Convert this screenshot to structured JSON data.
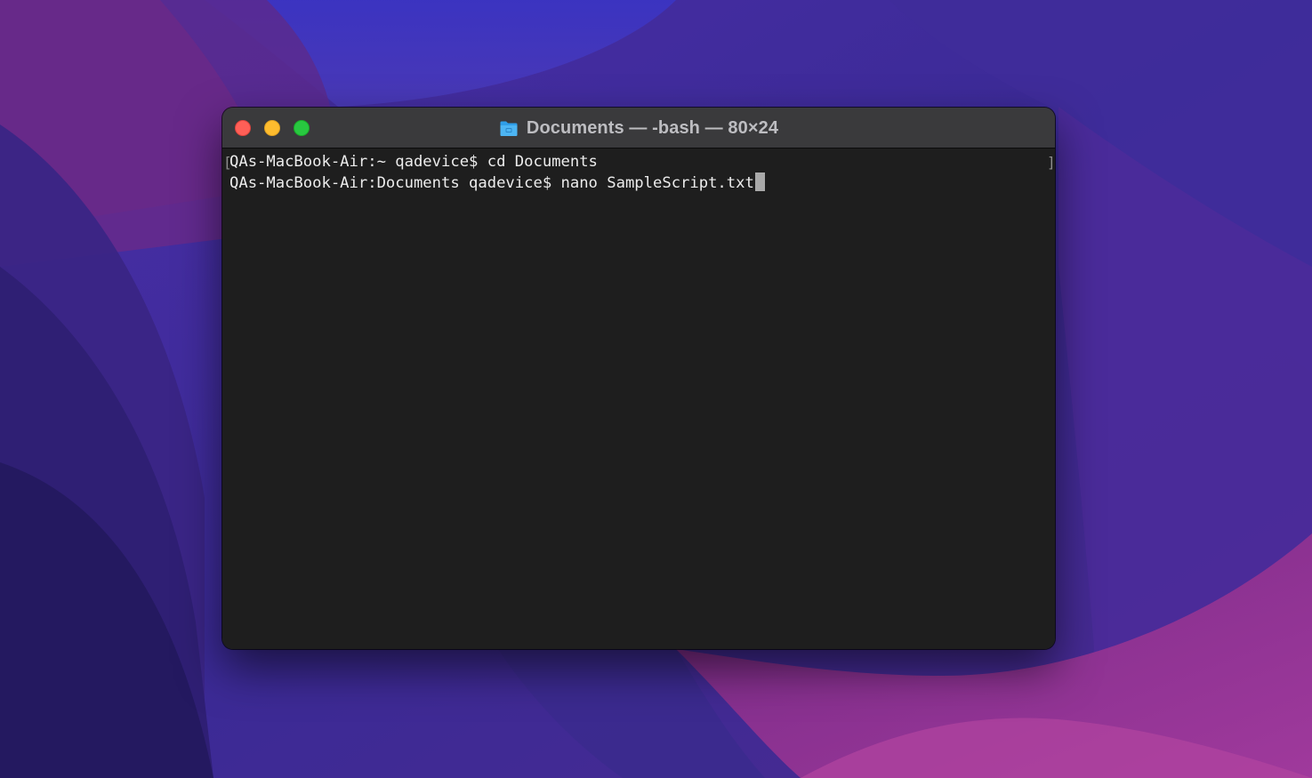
{
  "window": {
    "title": "Documents — -bash — 80×24",
    "title_icon": "folder-icon",
    "traffic_lights": {
      "close": "#ff5f57",
      "minimize": "#febc2e",
      "maximize": "#28c840"
    }
  },
  "terminal": {
    "background": "#1e1e1e",
    "foreground": "#ececec",
    "lines": [
      "QAs-MacBook-Air:~ qadevice$ cd Documents",
      "QAs-MacBook-Air:Documents qadevice$ nano SampleScript.txt"
    ],
    "marker_left": "[",
    "marker_right": "]"
  }
}
